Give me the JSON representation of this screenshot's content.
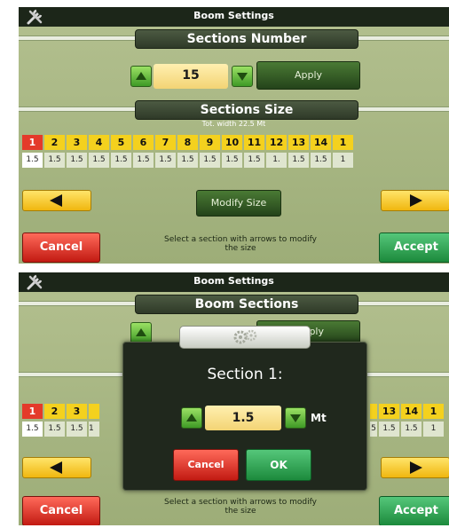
{
  "colors": {
    "panel": "#a7b582",
    "header": "#1c2619",
    "selected_section": "#e43a2a",
    "section_number": "#f4d11e",
    "cancel": "#d9261a",
    "accept": "#22a04a"
  },
  "icons": {
    "tools": "tools-icon",
    "gears": "gears-icon",
    "up": "up-arrow-icon",
    "down": "down-arrow-icon",
    "left": "left-arrow-icon",
    "right": "right-arrow-icon"
  },
  "screen1": {
    "title": "Boom Settings",
    "sections_number_banner": "Sections Number",
    "sections_number_value": "15",
    "apply_label": "Apply",
    "sections_size_banner": "Sections Size",
    "total_width": "Tot. width 22.5 Mt",
    "section_numbers": [
      "1",
      "2",
      "3",
      "4",
      "5",
      "6",
      "7",
      "8",
      "9",
      "10",
      "11",
      "12",
      "13",
      "14",
      "1"
    ],
    "section_values": [
      "1.5",
      "1.5",
      "1.5",
      "1.5",
      "1.5",
      "1.5",
      "1.5",
      "1.5",
      "1.5",
      "1.5",
      "1.5",
      "1.",
      "1.5",
      "1.5",
      "1"
    ],
    "modify_size_label": "Modify Size",
    "cancel_label": "Cancel",
    "hint": "Select a section with arrows to modify the size",
    "accept_label": "Accept"
  },
  "screen2": {
    "title": "Boom Settings",
    "banner": "Boom Sections",
    "apply_peek": "ply",
    "left_numbers": [
      "1",
      "2",
      "3"
    ],
    "left_values": [
      "1.5",
      "1.5",
      "1.5"
    ],
    "left_partial_value": "1",
    "right_numbers": [
      "13",
      "14",
      "1"
    ],
    "right_values": [
      "1.5",
      "1.5",
      "1"
    ],
    "right_partial_value": "5",
    "dialog": {
      "title": "Section 1:",
      "value": "1.5",
      "unit": "Mt",
      "cancel_label": "Cancel",
      "ok_label": "OK"
    },
    "cancel_label": "Cancel",
    "hint": "Select a section with arrows to modify the size",
    "accept_label": "Accept"
  }
}
